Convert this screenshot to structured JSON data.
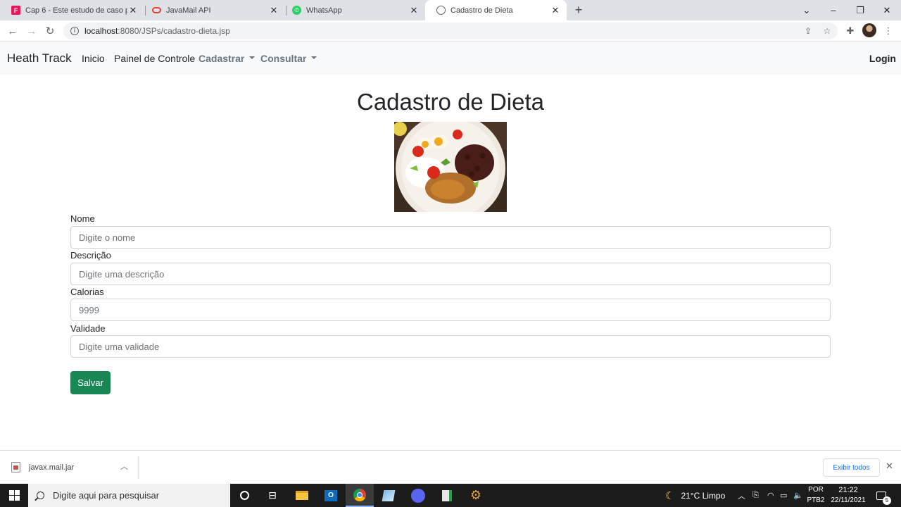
{
  "browser": {
    "tabs": [
      {
        "title": "Cap 6 - Este estudo de caso pode",
        "favicon": "fiap-icon",
        "favicon_color": "#ed145b",
        "active": false
      },
      {
        "title": "JavaMail API",
        "favicon": "oracle-icon",
        "favicon_color": "#e8402f",
        "active": false
      },
      {
        "title": "WhatsApp",
        "favicon": "whatsapp-icon",
        "favicon_color": "#25d366",
        "active": false
      },
      {
        "title": "Cadastro de Dieta",
        "favicon": "globe-icon",
        "favicon_color": "#5f6368",
        "active": true
      }
    ],
    "new_tab": "+",
    "url": {
      "host": "localhost",
      "path": ":8080/JSPs/cadastro-dieta.jsp"
    }
  },
  "navbar": {
    "brand": "Heath Track",
    "links": [
      {
        "label": "Inicio"
      },
      {
        "label": "Painel de Controle"
      },
      {
        "label": "Cadastrar",
        "dropdown": true
      },
      {
        "label": "Consultar",
        "dropdown": true
      }
    ],
    "login": "Login"
  },
  "main": {
    "title": "Cadastro de Dieta",
    "image": "dish-of-rice-beans-eggs-tomato",
    "fields": [
      {
        "label": "Nome",
        "placeholder": "Digite o nome"
      },
      {
        "label": "Descrição",
        "placeholder": "Digite uma descrição"
      },
      {
        "label": "Calorias",
        "placeholder": "9999"
      },
      {
        "label": "Validade",
        "placeholder": "Digite uma validade"
      }
    ],
    "save_label": "Salvar",
    "save_color": "#198754"
  },
  "downloads": {
    "file": "javax.mail.jar",
    "show_all": "Exibir todos"
  },
  "taskbar": {
    "search_placeholder": "Digite aqui para pesquisar",
    "weather": "21°C  Limpo",
    "lang_top": "POR",
    "lang_bottom": "PTB2",
    "time": "21:22",
    "date": "22/11/2021",
    "notifications": "5"
  }
}
